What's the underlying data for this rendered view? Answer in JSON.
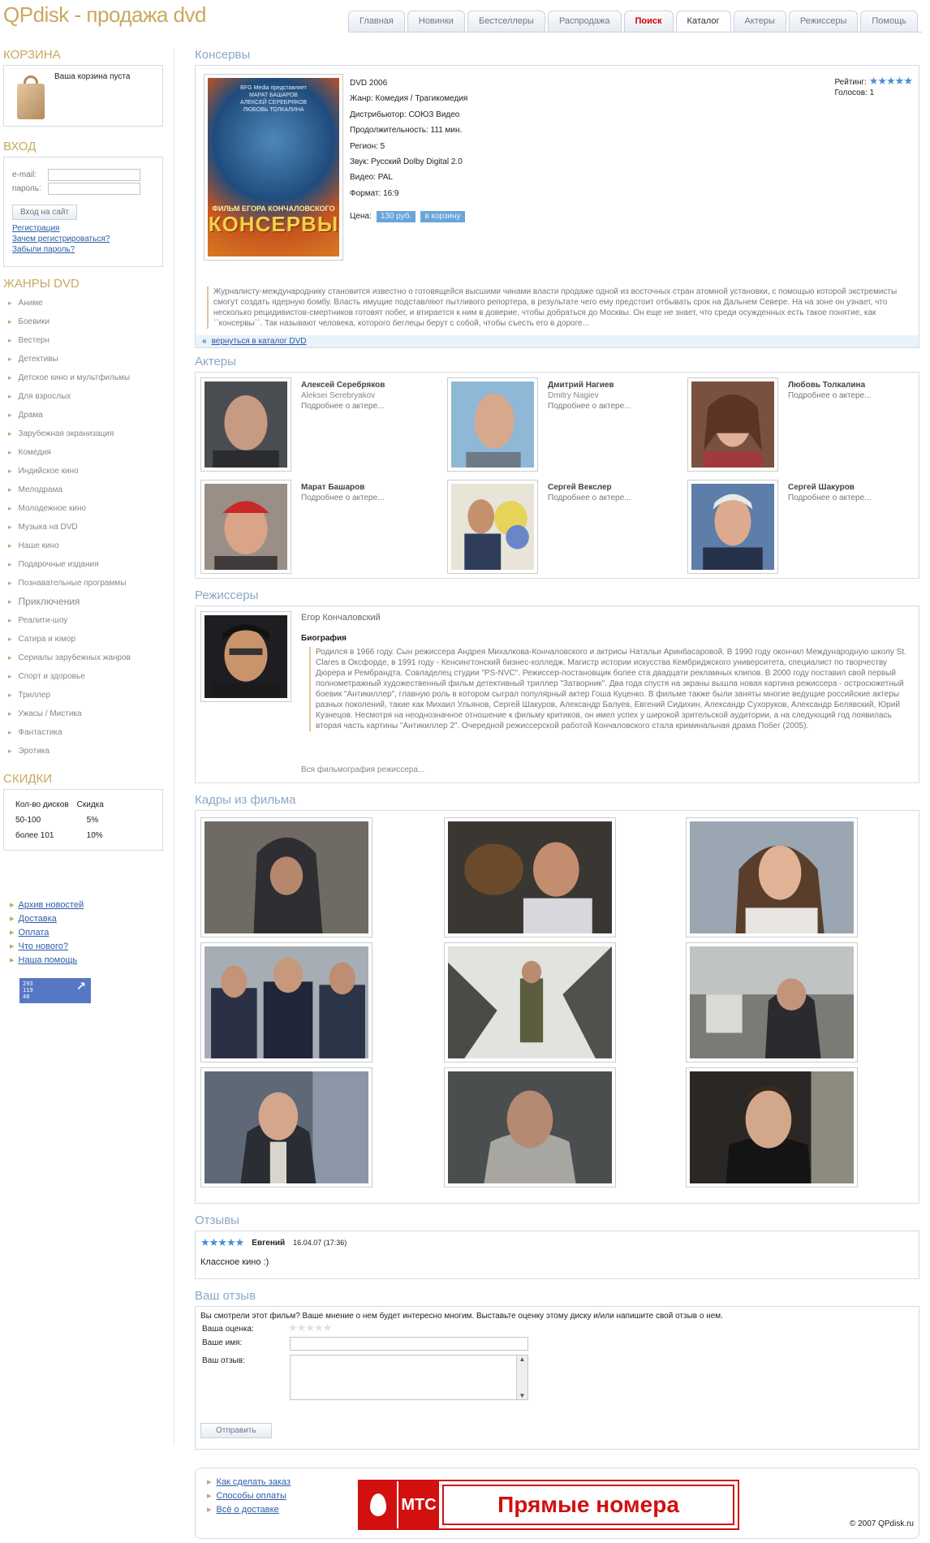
{
  "site": {
    "logo": "QPdisk - продажа dvd"
  },
  "tabs": [
    "Главная",
    "Новинки",
    "Бестселлеры",
    "Распродажа",
    "Поиск",
    "Каталог",
    "Актеры",
    "Режиссеры",
    "Помощь"
  ],
  "left": {
    "cart_title": "КОРЗИНА",
    "cart_empty": "Ваша корзина пуста",
    "login_title": "ВХОД",
    "email_label": "e-mail:",
    "password_label": "пароль:",
    "login_button": "Вход на сайт",
    "links": [
      "Регистрация",
      "Зачем регистрироваться?",
      "Забыли пароль?"
    ],
    "genres_title": "ЖАНРЫ DVD",
    "genres": [
      "Аниме",
      "Боевики",
      "Вестерн",
      "Детективы",
      "Детское кино и мультфильмы",
      "Для взрослых",
      "Драма",
      "Зарубежная экранизация",
      "Комедия",
      "Индийское кино",
      "Мелодрама",
      "Молодежное кино",
      "Музыка на DVD",
      "Наше кино",
      "Подарочные издания",
      "Познавательные программы",
      "Приключения",
      "Реалити-шоу",
      "Сатира и юмор",
      "Сериалы зарубежных жанров",
      "Спорт и здоровье",
      "Триллер",
      "Ужасы / Мистика",
      "Фантастика",
      "Эротика"
    ],
    "discount_title": "СКИДКИ",
    "discount_headers": [
      "Кол-во дисков",
      "Скидка"
    ],
    "discount_rows": [
      [
        "50-100",
        "5%"
      ],
      [
        "более 101",
        "10%"
      ]
    ],
    "footer_links": [
      "Архив новостей",
      "Доставка",
      "Оплата",
      "Что нового?",
      "Наша помощь"
    ],
    "counter": [
      "293",
      "119",
      "48"
    ]
  },
  "movie": {
    "title": "Консервы",
    "poster_top": "BFG Media представляет\nМАРАТ БАШАРОВ\nАЛЕКСЕЙ СЕРЕБРЯКОВ\nЛЮБОВЬ ТОЛКАЛИНА",
    "poster_sub": "ФИЛЬМ ЕГОРА КОНЧАЛОВСКОГО",
    "poster_title": "КОНСЕРВЫ",
    "info": [
      "DVD 2006",
      "Жанр: Комедия / Трагикомедия",
      "Дистрибьютор: СОЮЗ Видео",
      "Продолжительность: 111 мин.",
      "Регион: 5",
      "Звук: Русский Dolby Digital 2.0",
      "Видео: PAL",
      "Формат: 16:9"
    ],
    "price_label": "Цена:",
    "price": "130 руб.",
    "cart_button": "в корзину",
    "rating_label": "Рейтинг:",
    "rating": 5,
    "votes": "Голосов: 1",
    "description": "Журналисту-международнику становится известно о готовящейся высшими чинами власти продаже одной из восточных стран атомной установки, с помощью которой экстремисты смогут создать ядерную бомбу. Власть имущие подставляют пытливого репортера, в результате чего ему предстоит отбывать срок на Дальнем Севере. На на зоне он узнает, что несколько рецидивистов-смертников готовят побег, и втирается к ним в доверие, чтобы добраться до Москвы. Он еще не знает, что среди осужденных есть такое понятие, как ``консервы``. Так называют человека, которого беглецы берут с собой, чтобы съесть его в дороге...",
    "back_link": "вернуться в каталог DVD"
  },
  "actors": {
    "title": "Актеры",
    "items": [
      {
        "name": "Алексей Серебряков",
        "en": "Aleksei Serebryakov",
        "more": "Подробнее о актере..."
      },
      {
        "name": "Дмитрий Нагиев",
        "en": "Dmitry Nagiev",
        "more": "Подробнее о актере..."
      },
      {
        "name": "Любовь Толкалина",
        "en": "",
        "more": "Подробнее о актере..."
      },
      {
        "name": "Марат Башаров",
        "en": "",
        "more": "Подробнее о актере..."
      },
      {
        "name": "Сергей Векслер",
        "en": "",
        "more": "Подробнее о актере..."
      },
      {
        "name": "Сергей Шакуров",
        "en": "",
        "more": "Подробнее о актере..."
      }
    ]
  },
  "director": {
    "title": "Режиссеры",
    "name": "Егор Кончаловский",
    "bio_title": "Биография",
    "bio": "Родился в 1966 году. Сын режиссера Андрея Михалкова-Кончаловского и актрисы Натальи Аринбасаровой. В 1990 году окончил Международную школу St. Clares в Оксфорде, в 1991 году - Кенсингтонский бизнес-колледж. Магистр истории искусства Кембриджского университета, специалист по творчеству Дюрера и Рембрандта. Совладелец студии \"PS-NVC\". Режиссер-постановщик более ста двадцати рекламных клипов. В 2000 году поставил свой первый полнометражный художественный фильм детективный триллер \"Затворник\". Два года спустя на экраны вышла новая картина режиссера - остросюжетный боевик \"Антикиллер\", главную роль в котором сыграл популярный актер Гоша Куценко. В фильме также были заняты многие ведущие российские актеры разных поколений, такие как Михаил Ульянов, Сергей Шакуров, Александр Балуев, Евгений Сидихин, Александр Сухоруков, Александр Белявский, Юрий Кузнецов. Несмотря на неоднозначное отношение к фильму критиков, он имел успех у широкой зрительской аудитории, а на следующий год появилась вторая часть картины \"Антикиллер 2\". Очередной режиссерской работой Кончаловского стала криминальная драма Побег (2005).",
    "filmography": "Вся фильмография режиссера..."
  },
  "frames": {
    "title": "Кадры из фильма",
    "count": 9
  },
  "reviews": {
    "title": "Отзывы",
    "items": [
      {
        "stars": 5,
        "author": "Евгений",
        "date": "16.04.07 (17:36)",
        "text": "Классное кино :)"
      }
    ]
  },
  "your_review": {
    "title": "Ваш отзыв",
    "intro": "Вы смотрели этот фильм? Ваше мнение о нем будет интересно многим. Выставьте оценку этому диску и/или напишите свой отзыв о нем.",
    "rating_label": "Ваша оценка:",
    "name_label": "Ваше имя:",
    "review_label": "Ваш отзыв:",
    "submit": "Отправить"
  },
  "footer": {
    "links": [
      "Как сделать заказ",
      "Способы оплаты",
      "Всё о доставке"
    ],
    "banner_brand": "МТС",
    "banner_text": "Прямые номера",
    "copyright": "© 2007 QPdisk.ru"
  },
  "colors": {
    "accent": "#c9a85e",
    "link": "#2a5ca8",
    "section_title": "#8aa8c8",
    "mts_red": "#d21010"
  }
}
